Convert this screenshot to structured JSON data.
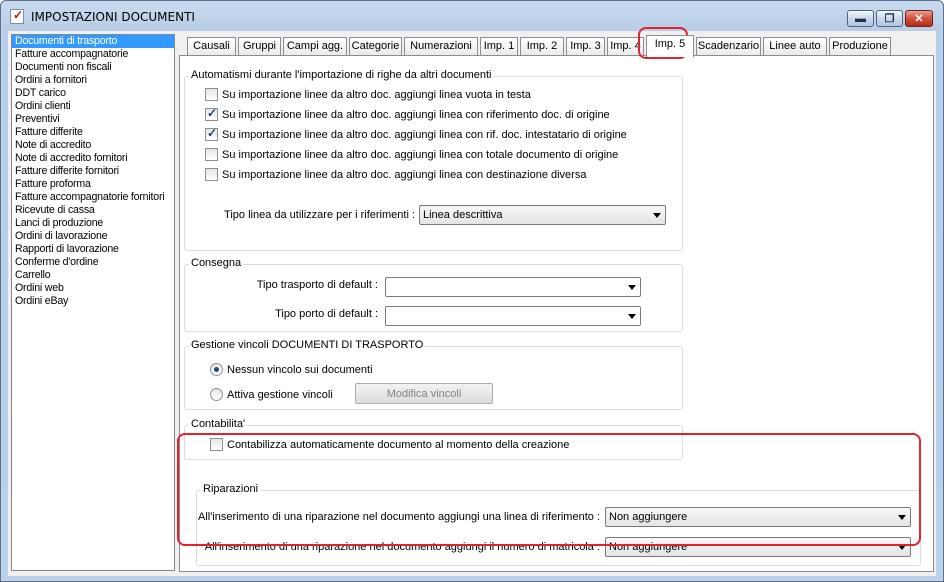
{
  "window": {
    "title": "IMPOSTAZIONI DOCUMENTI",
    "buttons": {
      "minimize": "▬",
      "maximize": "❐",
      "close": "✕"
    },
    "icons": {
      "app": "document-check-icon"
    }
  },
  "doclist": {
    "items": [
      "Documenti di trasporto",
      "Fatture accompagnatorie",
      "Documenti non fiscali",
      "Ordini a fornitori",
      "DDT carico",
      "Ordini clienti",
      "Preventivi",
      "Fatture differite",
      "Note di accredito",
      "Note di accredito fornitori",
      "Fatture differite fornitori",
      "Fatture proforma",
      "Fatture accompagnatorie fornitori",
      "Ricevute di cassa",
      "Lanci di produzione",
      "Ordini di lavorazione",
      "Rapporti di lavorazione",
      "Conferme d'ordine",
      "Carrello",
      "Ordini web",
      "Ordini eBay"
    ],
    "selected_index": 0
  },
  "tabs": [
    "Causali",
    "Gruppi",
    "Campi agg.",
    "Categorie",
    "Numerazioni",
    "Imp. 1",
    "Imp. 2",
    "Imp. 3",
    "Imp. 4",
    "Imp. 5",
    "Scadenzario",
    "Linee auto",
    "Produzione"
  ],
  "active_tab": "Imp. 5",
  "automatismi": {
    "title": "Automatismi durante l'importazione di righe da altri documenti",
    "options": [
      {
        "label": "Su importazione linee da altro doc. aggiungi linea vuota in testa",
        "checked": false
      },
      {
        "label": "Su importazione linee da altro doc. aggiungi linea con riferimento doc. di origine",
        "checked": true
      },
      {
        "label": "Su importazione linee da altro doc. aggiungi linea con rif. doc. intestatario di origine",
        "checked": true
      },
      {
        "label": "Su importazione linee da altro doc. aggiungi linea con totale documento di origine",
        "checked": false
      },
      {
        "label": "Su importazione linee da altro doc. aggiungi linea con destinazione diversa",
        "checked": false
      }
    ],
    "tipo_linea_label": "Tipo linea da utilizzare per i riferimenti :",
    "tipo_linea_value": "Linea descrittiva"
  },
  "consegna": {
    "title": "Consegna",
    "trasporto_label": "Tipo trasporto di default :",
    "trasporto_value": "",
    "porto_label": "Tipo porto di default :",
    "porto_value": ""
  },
  "vincoli": {
    "title": "Gestione vincoli DOCUMENTI DI TRASPORTO",
    "nessuno_label": "Nessun vincolo sui documenti",
    "nessuno_selected": true,
    "attiva_label": "Attiva gestione vincoli",
    "attiva_selected": false,
    "modifica_button": "Modifica vincoli"
  },
  "contabilita": {
    "title": "Contabilita'",
    "option_label": "Contabilizza automaticamente documento al momento della creazione",
    "checked": false
  },
  "riparazioni": {
    "title": "Riparazioni",
    "linea_label": "All'inserimento di una riparazione nel documento aggiungi una linea di riferimento :",
    "linea_value": "Non aggiungere",
    "matricola_label": "All'inserimento di una riparazione nel documento aggiungi il numero di matricola :",
    "matricola_value": "Non aggiungere"
  },
  "colors": {
    "selection": "#3399ff",
    "highlight": "#e0242c",
    "window_frame": "#b8cde6"
  }
}
